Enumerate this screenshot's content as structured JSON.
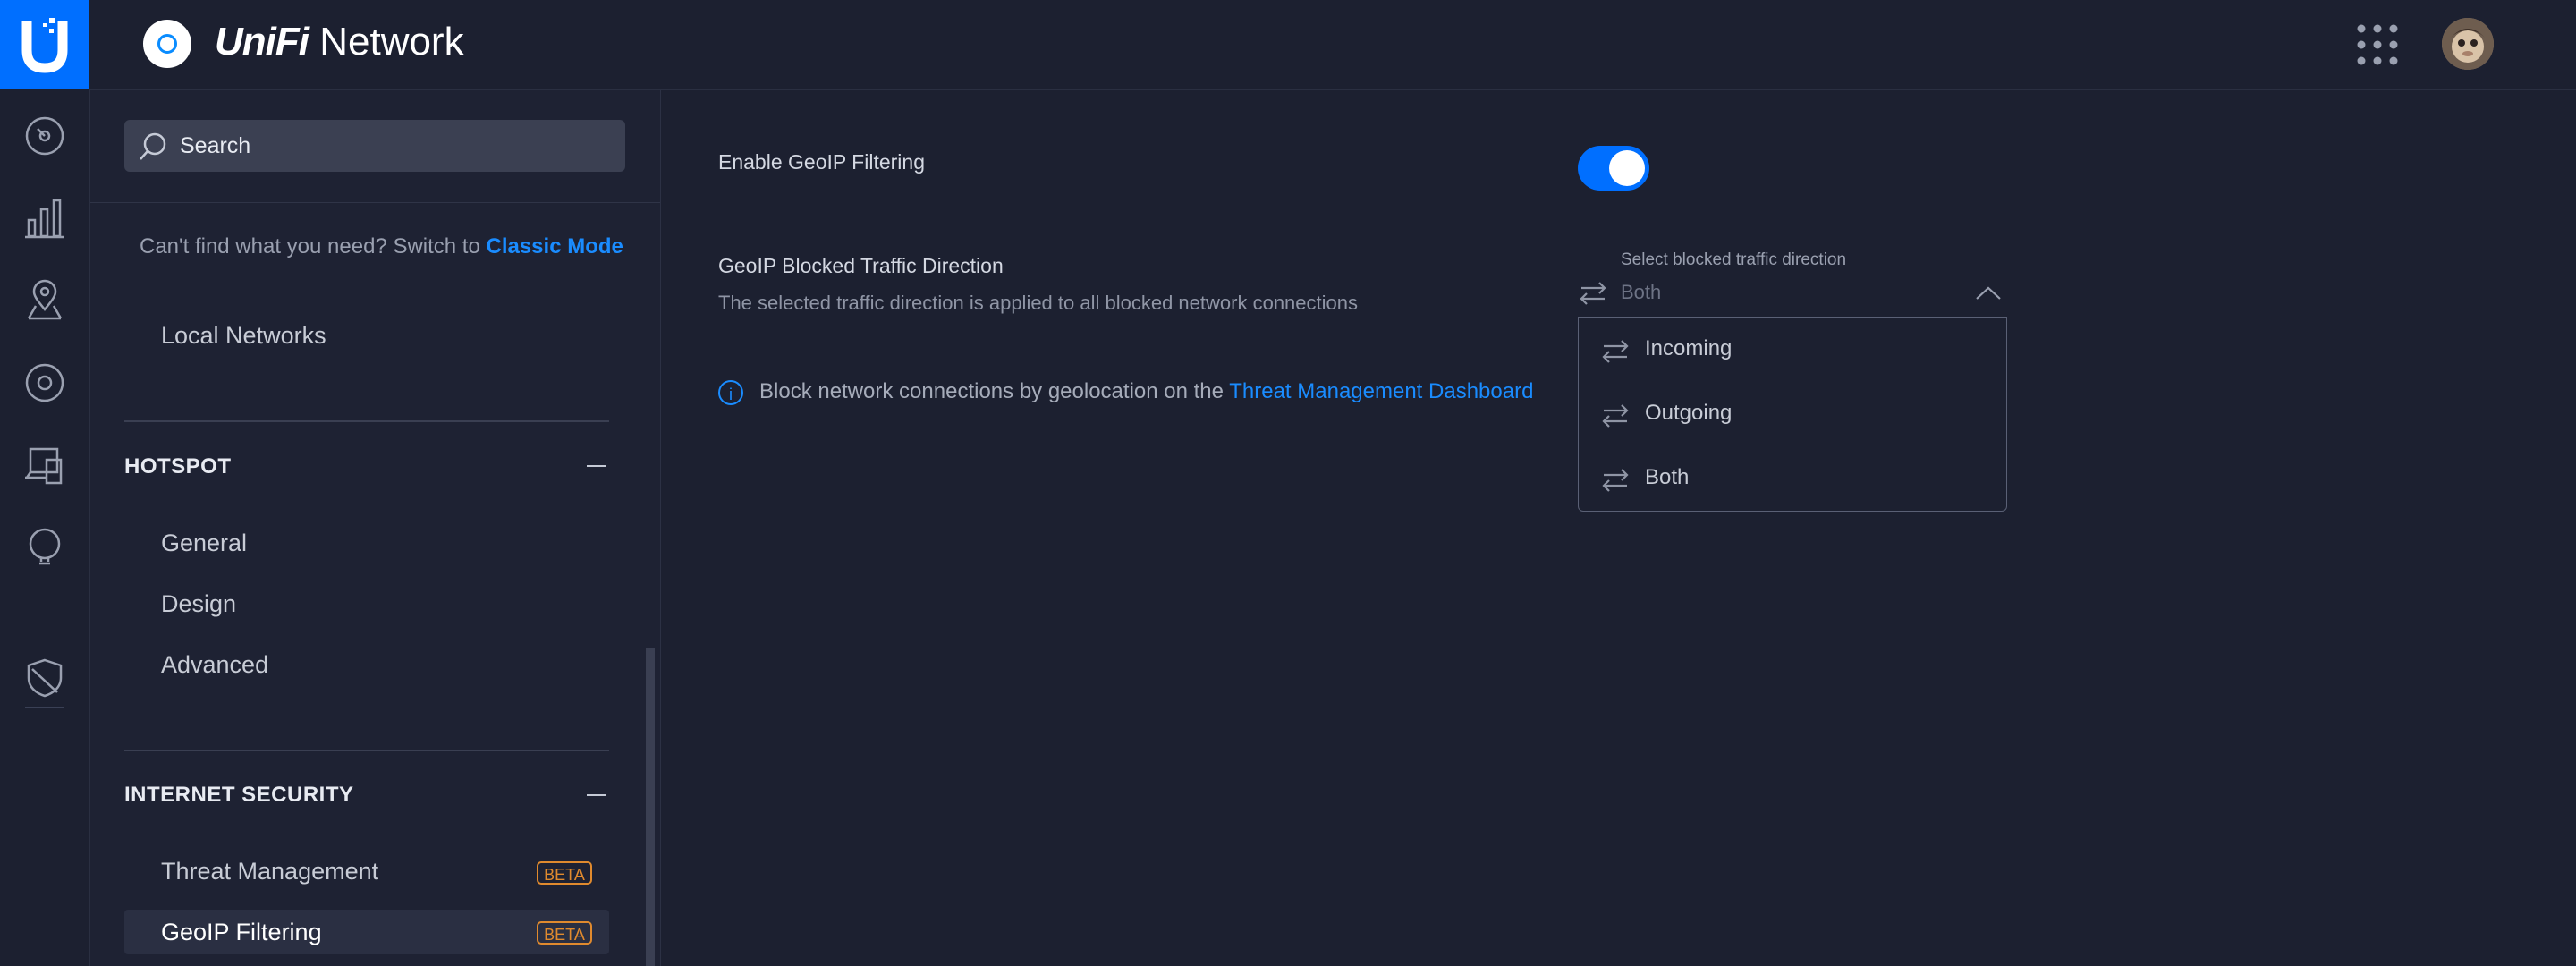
{
  "header": {
    "brand_part1": "UniFi",
    "brand_part2": "Network",
    "accent_color": "#006fff"
  },
  "rail": {
    "icons": [
      "dashboard-icon",
      "statistics-icon",
      "map-icon",
      "devices-icon",
      "clients-icon",
      "insights-icon",
      "shield-icon"
    ]
  },
  "sidebar": {
    "search_placeholder": "Search",
    "classic_hint": "Can't find what you need? Switch to",
    "classic_link": "Classic Mode",
    "local_networks": "Local Networks",
    "hotspot": {
      "title": "HOTSPOT",
      "items": [
        "General",
        "Design",
        "Advanced"
      ]
    },
    "internet_security": {
      "title": "INTERNET SECURITY",
      "items": [
        {
          "label": "Threat Management",
          "badge": "BETA"
        },
        {
          "label": "GeoIP Filtering",
          "badge": "BETA",
          "selected": true
        }
      ]
    }
  },
  "main": {
    "enable_label": "Enable GeoIP Filtering",
    "enable_state": true,
    "direction_title": "GeoIP Blocked Traffic Direction",
    "direction_desc": "The selected traffic direction is applied to all blocked network connections",
    "info_text": "Block network connections by geolocation on the",
    "info_link": "Threat Management Dashboard",
    "select": {
      "caption": "Select blocked traffic direction",
      "value": "Both",
      "options": [
        "Incoming",
        "Outgoing",
        "Both"
      ]
    }
  }
}
